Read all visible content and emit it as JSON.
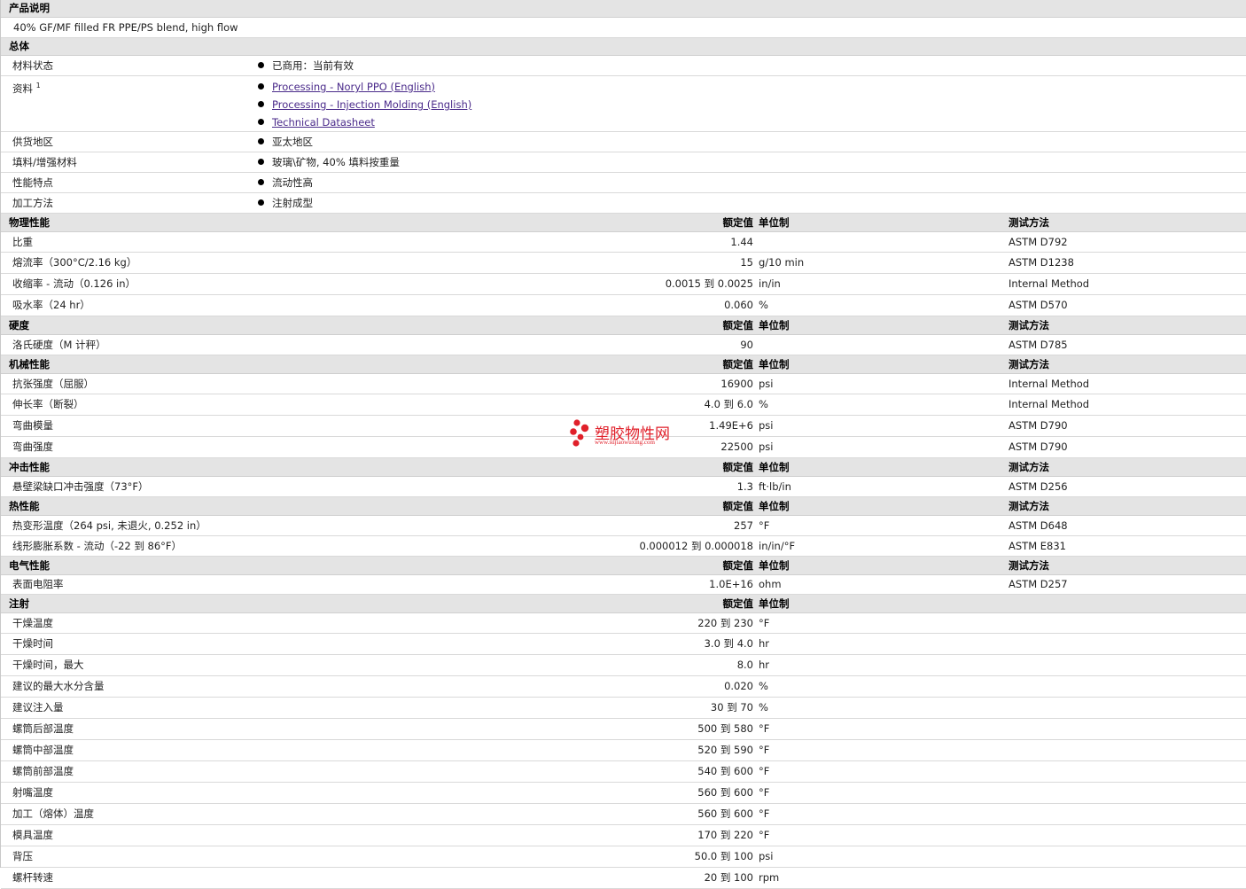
{
  "sections": {
    "description": {
      "title": "产品说明",
      "text": "40% GF/MF filled FR PPE/PS blend, high flow"
    },
    "general": {
      "title": "总体",
      "status": {
        "label": "材料状态",
        "value": "已商用：当前有效"
      },
      "docs": {
        "label": "资料",
        "sup": "1",
        "links": [
          "Processing - Noryl PPO (English)",
          "Processing - Injection Molding (English)",
          "Technical Datasheet"
        ]
      },
      "region": {
        "label": "供货地区",
        "value": "亚太地区"
      },
      "filler": {
        "label": "填料/增强材料",
        "value": "玻璃\\矿物, 40% 填料按重量"
      },
      "features": {
        "label": "性能特点",
        "value": "流动性高"
      },
      "method": {
        "label": "加工方法",
        "value": "注射成型"
      }
    },
    "col_headers": {
      "value": "额定值",
      "unit": "单位制",
      "test": "测试方法"
    },
    "physical": {
      "title": "物理性能",
      "rows": [
        {
          "name": "比重",
          "value": "1.44",
          "unit": "",
          "test": "ASTM D792"
        },
        {
          "name": "熔流率（300°C/2.16 kg）",
          "value": "15",
          "unit": "g/10 min",
          "test": "ASTM D1238"
        },
        {
          "name": "收缩率 - 流动（0.126 in）",
          "value": "0.0015 到 0.0025",
          "unit": "in/in",
          "test": "Internal Method"
        },
        {
          "name": "吸水率（24 hr）",
          "value": "0.060",
          "unit": "%",
          "test": "ASTM D570"
        }
      ]
    },
    "hardness": {
      "title": "硬度",
      "rows": [
        {
          "name": "洛氏硬度（M 计秤）",
          "value": "90",
          "unit": "",
          "test": "ASTM D785"
        }
      ]
    },
    "mechanical": {
      "title": "机械性能",
      "rows": [
        {
          "name": "抗张强度（屈服）",
          "value": "16900",
          "unit": "psi",
          "test": "Internal Method"
        },
        {
          "name": "伸长率（断裂）",
          "value": "4.0 到 6.0",
          "unit": "%",
          "test": "Internal Method"
        },
        {
          "name": "弯曲模量",
          "value": "1.49E+6",
          "unit": "psi",
          "test": "ASTM D790"
        },
        {
          "name": "弯曲强度",
          "value": "22500",
          "unit": "psi",
          "test": "ASTM D790"
        }
      ]
    },
    "impact": {
      "title": "冲击性能",
      "rows": [
        {
          "name": "悬壁梁缺口冲击强度（73°F）",
          "value": "1.3",
          "unit": "ft·lb/in",
          "test": "ASTM D256"
        }
      ]
    },
    "thermal": {
      "title": "热性能",
      "rows": [
        {
          "name": "热变形温度（264 psi, 未退火, 0.252 in）",
          "value": "257",
          "unit": "°F",
          "test": "ASTM D648"
        },
        {
          "name": "线形膨胀系数 - 流动（-22 到 86°F）",
          "value": "0.000012 到 0.000018",
          "unit": "in/in/°F",
          "test": "ASTM E831"
        }
      ]
    },
    "electrical": {
      "title": "电气性能",
      "rows": [
        {
          "name": "表面电阻率",
          "value": "1.0E+16",
          "unit": "ohm",
          "test": "ASTM D257"
        }
      ]
    },
    "injection": {
      "title": "注射",
      "rows": [
        {
          "name": "干燥温度",
          "value": "220 到 230",
          "unit": "°F",
          "test": ""
        },
        {
          "name": "干燥时间",
          "value": "3.0 到 4.0",
          "unit": "hr",
          "test": ""
        },
        {
          "name": "干燥时间，最大",
          "value": "8.0",
          "unit": "hr",
          "test": ""
        },
        {
          "name": "建议的最大水分含量",
          "value": "0.020",
          "unit": "%",
          "test": ""
        },
        {
          "name": "建议注入量",
          "value": "30 到 70",
          "unit": "%",
          "test": ""
        },
        {
          "name": "螺筒后部温度",
          "value": "500 到 580",
          "unit": "°F",
          "test": ""
        },
        {
          "name": "螺筒中部温度",
          "value": "520 到 590",
          "unit": "°F",
          "test": ""
        },
        {
          "name": "螺筒前部温度",
          "value": "540 到 600",
          "unit": "°F",
          "test": ""
        },
        {
          "name": "射嘴温度",
          "value": "560 到 600",
          "unit": "°F",
          "test": ""
        },
        {
          "name": "加工（熔体）温度",
          "value": "560 到 600",
          "unit": "°F",
          "test": ""
        },
        {
          "name": "模具温度",
          "value": "170 到 220",
          "unit": "°F",
          "test": ""
        },
        {
          "name": "背压",
          "value": "50.0 到 100",
          "unit": "psi",
          "test": ""
        },
        {
          "name": "螺杆转速",
          "value": "20 到 100",
          "unit": "rpm",
          "test": ""
        }
      ]
    }
  },
  "watermark": {
    "text": "塑胶物性网",
    "url": "www.sujiaowuxing.com",
    "color": "#e0202a"
  }
}
